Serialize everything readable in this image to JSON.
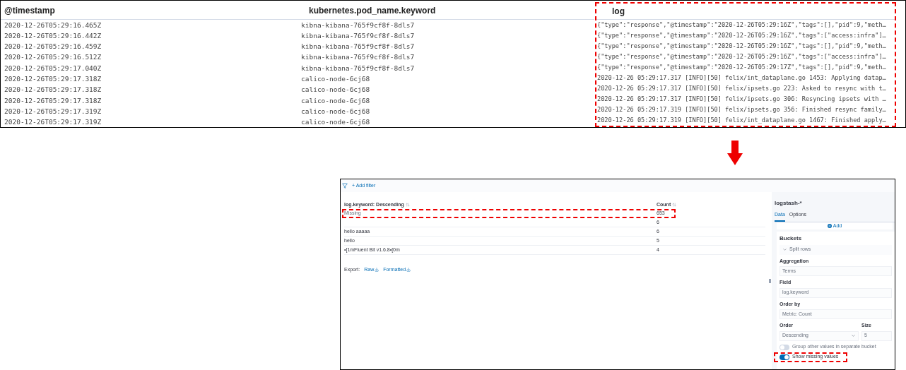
{
  "top_table": {
    "columns": [
      {
        "label": "@timestamp",
        "highlighted": false
      },
      {
        "label": "kubernetes.pod_name.keyword",
        "highlighted": false
      },
      {
        "label": "log",
        "highlighted": true
      }
    ],
    "rows": [
      [
        "2020-12-26T05:29:16.465Z",
        "kibna-kibana-765f9cf8f-8dls7",
        "{\"type\":\"response\",\"@timestamp\":\"2020-12-26T05:29:16Z\",\"tags\":[],\"pid\":9,\"meth…"
      ],
      [
        "2020-12-26T05:29:16.442Z",
        "kibna-kibana-765f9cf8f-8dls7",
        "{\"type\":\"response\",\"@timestamp\":\"2020-12-26T05:29:16Z\",\"tags\":[\"access:infra\"]…"
      ],
      [
        "2020-12-26T05:29:16.459Z",
        "kibna-kibana-765f9cf8f-8dls7",
        "{\"type\":\"response\",\"@timestamp\":\"2020-12-26T05:29:16Z\",\"tags\":[],\"pid\":9,\"meth…"
      ],
      [
        "2020-12-26T05:29:16.512Z",
        "kibna-kibana-765f9cf8f-8dls7",
        "{\"type\":\"response\",\"@timestamp\":\"2020-12-26T05:29:16Z\",\"tags\":[\"access:infra\"]…"
      ],
      [
        "2020-12-26T05:29:17.040Z",
        "kibna-kibana-765f9cf8f-8dls7",
        "{\"type\":\"response\",\"@timestamp\":\"2020-12-26T05:29:17Z\",\"tags\":[],\"pid\":9,\"meth…"
      ],
      [
        "2020-12-26T05:29:17.318Z",
        "calico-node-6cj68",
        "2020-12-26 05:29:17.317 [INFO][50] felix/int_dataplane.go 1453: Applying datap…"
      ],
      [
        "2020-12-26T05:29:17.318Z",
        "calico-node-6cj68",
        "2020-12-26 05:29:17.317 [INFO][50] felix/ipsets.go 223: Asked to resync with t…"
      ],
      [
        "2020-12-26T05:29:17.318Z",
        "calico-node-6cj68",
        "2020-12-26 05:29:17.317 [INFO][50] felix/ipsets.go 306: Resyncing ipsets with …"
      ],
      [
        "2020-12-26T05:29:17.319Z",
        "calico-node-6cj68",
        "2020-12-26 05:29:17.319 [INFO][50] felix/ipsets.go 356: Finished resync family…"
      ],
      [
        "2020-12-26T05:29:17.319Z",
        "calico-node-6cj68",
        "2020-12-26 05:29:17.319 [INFO][50] felix/int_dataplane.go 1467: Finished apply…"
      ]
    ]
  },
  "filter_bar": {
    "add_filter": "+ Add filter"
  },
  "result_table": {
    "columns": [
      "log.keyword: Descending",
      "Count"
    ],
    "rows": [
      {
        "key": "Missing",
        "count": "653",
        "highlighted": true
      },
      {
        "count": "6",
        "highlighted": false
      },
      {
        "key": "hello aaaaa",
        "count": "6",
        "highlighted": false
      },
      {
        "key": "hello",
        "count": "5",
        "highlighted": false
      },
      {
        "key": "•[1mFluent Bit v1.6.8•[0m",
        "count": "4",
        "highlighted": false
      }
    ]
  },
  "export": {
    "label": "Export:",
    "links": [
      "Raw",
      "Formatted"
    ]
  },
  "editor": {
    "index_pattern": "logstash-*",
    "tabs": [
      {
        "label": "Data",
        "selected": true
      },
      {
        "label": "Options",
        "selected": false
      }
    ],
    "add_label": "Add",
    "buckets_title": "Buckets",
    "split_label": "Split rows",
    "fields": [
      {
        "label": "Aggregation",
        "value": "Terms"
      },
      {
        "label": "Field",
        "value": "log.keyword"
      },
      {
        "label": "Order by",
        "value": "Metric: Count"
      }
    ],
    "order": {
      "label": "Order",
      "value": "Descending"
    },
    "size": {
      "label": "Size",
      "value": "5"
    },
    "switches": [
      {
        "label": "Group other values in separate bucket",
        "on": false,
        "highlighted": false
      },
      {
        "label": "Show missing values",
        "on": true,
        "highlighted": true
      }
    ]
  }
}
